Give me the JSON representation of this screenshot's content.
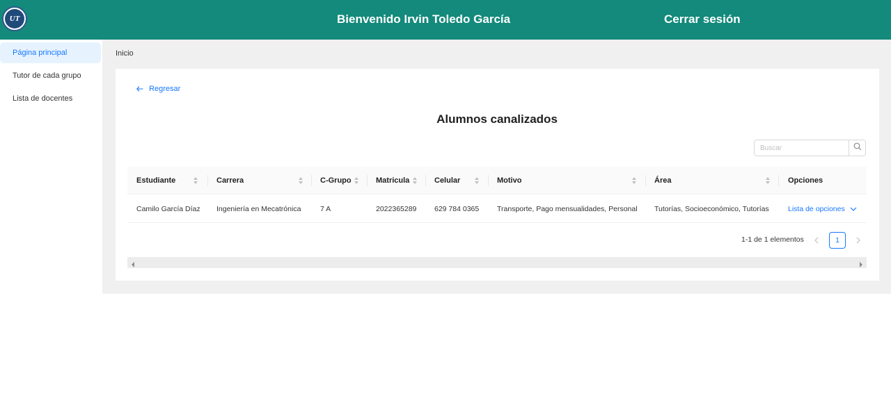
{
  "header": {
    "welcome": "Bienvenido Irvin Toledo García",
    "logout": "Cerrar sesión",
    "logo_text": "UT"
  },
  "sidebar": {
    "items": [
      {
        "label": "Página principal",
        "active": true
      },
      {
        "label": "Tutor de cada grupo",
        "active": false
      },
      {
        "label": "Lista de docentes",
        "active": false
      }
    ]
  },
  "breadcrumb": "Inicio",
  "page": {
    "back": "Regresar",
    "title": "Alumnos canalizados",
    "search_placeholder": "Buscar"
  },
  "table": {
    "columns": [
      "Estudiante",
      "Carrera",
      "C-Grupo",
      "Matricula",
      "Celular",
      "Motivo",
      "Área",
      "Opciones"
    ],
    "rows": [
      {
        "estudiante": "Camilo García Díaz",
        "carrera": "Ingeniería en Mecatrónica",
        "grupo": "7 A",
        "matricula": "2022365289",
        "celular": "629 784 0365",
        "motivo": "Transporte, Pago mensualidades, Personal",
        "area": "Tutorías, Socioeconómico, Tutorías",
        "opciones": "Lista de opciones"
      }
    ]
  },
  "pagination": {
    "summary": "1-1 de 1 elementos",
    "current_page": "1"
  },
  "colors": {
    "header": "#138a7b",
    "accent": "#1677ff",
    "content_bg": "#f0f0f0"
  },
  "icons": [
    "logo-icon",
    "arrow-left-icon",
    "search-icon",
    "sort-icon",
    "chevron-down-icon",
    "chevron-left-icon",
    "chevron-right-icon"
  ]
}
